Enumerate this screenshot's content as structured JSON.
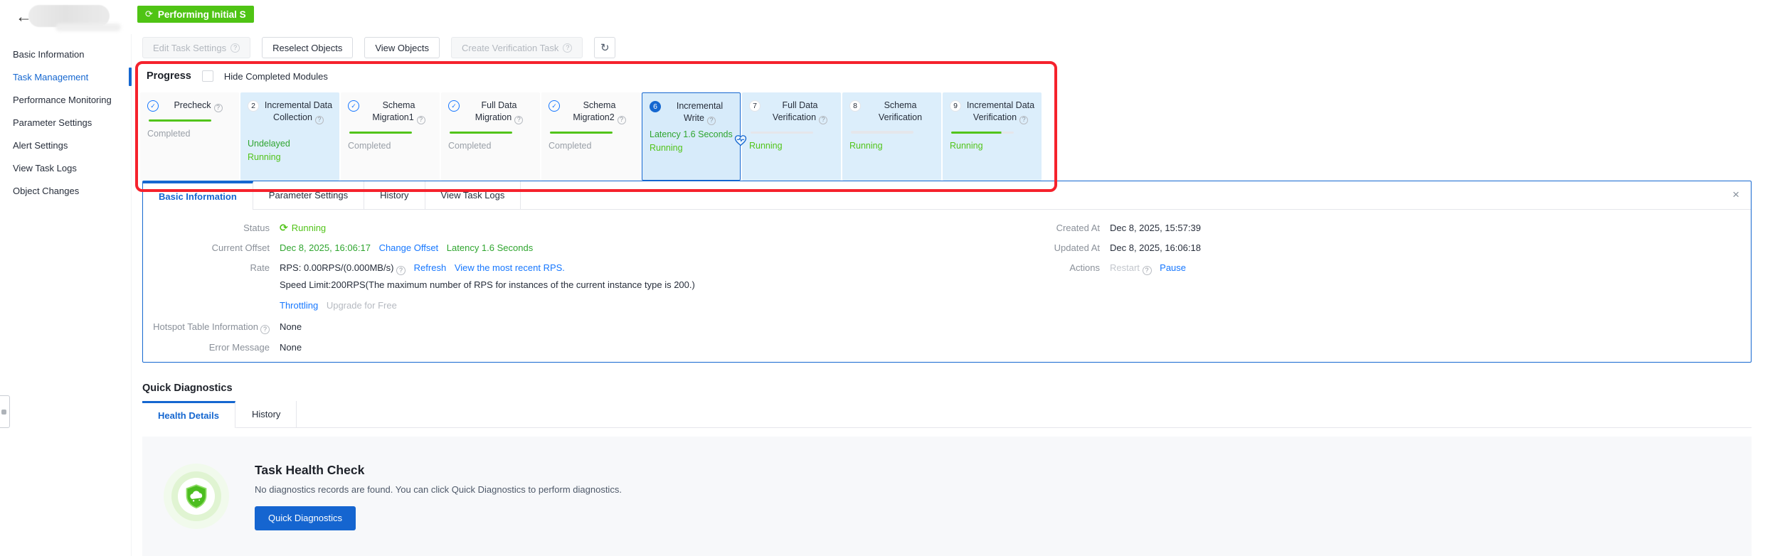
{
  "header": {
    "status_badge": "Performing Initial S"
  },
  "icons": {
    "back": "←",
    "sync": "⟳",
    "refresh": "↻",
    "help": "?",
    "check": "✓",
    "close": "×"
  },
  "sidebar": {
    "items": [
      "Basic Information",
      "Task Management",
      "Performance Monitoring",
      "Parameter Settings",
      "Alert Settings",
      "View Task Logs",
      "Object Changes"
    ],
    "active_item": "Task Management"
  },
  "toolbar": {
    "buttons": [
      {
        "label": "Edit Task Settings",
        "disabled": true,
        "help": true
      },
      {
        "label": "Reselect Objects",
        "disabled": false,
        "help": false
      },
      {
        "label": "View Objects",
        "disabled": false,
        "help": false
      },
      {
        "label": "Create Verification Task",
        "disabled": true,
        "help": true
      }
    ]
  },
  "progress": {
    "title": "Progress",
    "hide_completed_label": "Hide Completed Modules",
    "modules": [
      {
        "title": "Precheck",
        "state": "completed",
        "statuses": [
          "Completed"
        ]
      },
      {
        "num": "2",
        "title": "Incremental Data Collection",
        "state": "running",
        "statuses": [
          "Undelayed",
          "Running"
        ]
      },
      {
        "title": "Schema Migration1",
        "state": "completed",
        "statuses": [
          "Completed"
        ]
      },
      {
        "title": "Full Data Migration",
        "state": "completed",
        "statuses": [
          "Completed"
        ]
      },
      {
        "title": "Schema Migration2",
        "state": "completed",
        "statuses": [
          "Completed"
        ]
      },
      {
        "num": "6",
        "title": "Incremental Write",
        "state": "selected",
        "statuses": [
          "Latency 1.6 Seconds",
          "Running"
        ]
      },
      {
        "num": "7",
        "title": "Full Data Verification",
        "state": "running",
        "statuses": [
          "Running"
        ]
      },
      {
        "num": "8",
        "title": "Schema Verification",
        "state": "running",
        "statuses": [
          "Running"
        ]
      },
      {
        "num": "9",
        "title": "Incremental Data Verification",
        "state": "running",
        "statuses": [
          "Running"
        ]
      }
    ]
  },
  "detail_panel": {
    "tabs": [
      "Basic Information",
      "Parameter Settings",
      "History",
      "View Task Logs"
    ],
    "active_tab": "Basic Information",
    "status_label": "Status",
    "status_value": "Running",
    "current_offset_label": "Current Offset",
    "current_offset_time": "Dec 8, 2025, 16:06:17",
    "change_offset_link": "Change Offset",
    "latency_text": "Latency 1.6 Seconds",
    "rate_label": "Rate",
    "rate_value": "RPS: 0.00RPS/(0.000MB/s)",
    "refresh_link": "Refresh",
    "view_rps_link": "View the most recent RPS.",
    "speed_limit_text": "Speed Limit:200RPS(The maximum number of RPS for instances of the current instance type is 200.)",
    "throttling_link": "Throttling",
    "upgrade_label": "Upgrade for Free",
    "hotspot_label": "Hotspot Table Information",
    "hotspot_value": "None",
    "error_label": "Error Message",
    "error_value": "None",
    "created_label": "Created At",
    "created_value": "Dec 8, 2025, 15:57:39",
    "updated_label": "Updated At",
    "updated_value": "Dec 8, 2025, 16:06:18",
    "actions_label": "Actions",
    "restart_label": "Restart",
    "pause_label": "Pause"
  },
  "quick_diagnostics": {
    "title": "Quick Diagnostics",
    "tabs": [
      "Health Details",
      "History"
    ],
    "active_tab": "Health Details",
    "health_check": {
      "title": "Task Health Check",
      "description": "No diagnostics records are found. You can click Quick Diagnostics to perform diagnostics.",
      "button_label": "Quick Diagnostics"
    }
  },
  "colors": {
    "accent_blue": "#1567d0",
    "link_blue": "#1677ff",
    "running_green": "#52c41a",
    "dark_green": "#2fa52f",
    "badge_green": "#4fc414",
    "annotation_red": "#f5222d",
    "running_card_bg": "#dceefb",
    "completed_card_bg": "#fafafa",
    "health_card_bg": "#f7f8fa"
  }
}
